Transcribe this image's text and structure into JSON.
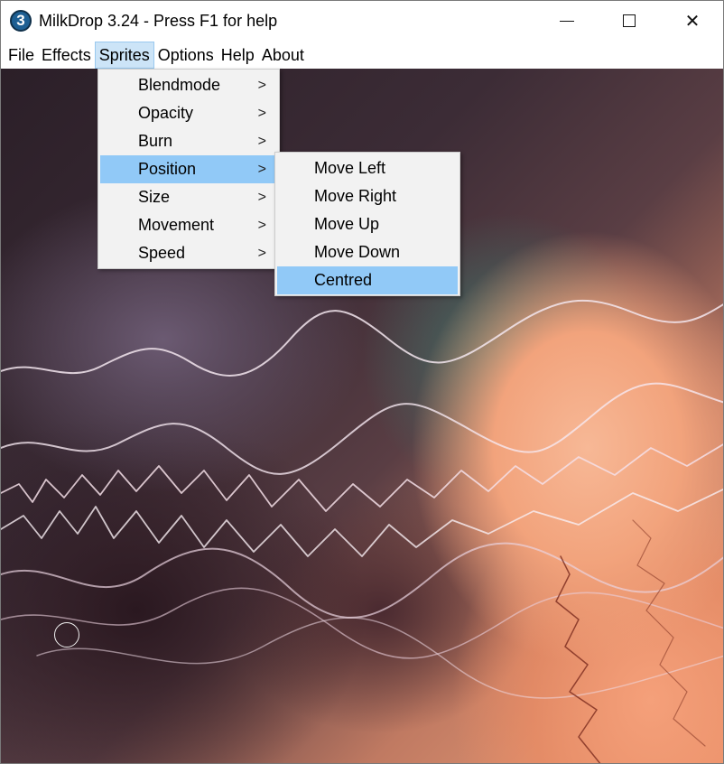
{
  "window": {
    "icon_text": "3",
    "title": "MilkDrop 3.24 - Press F1 for help",
    "controls": {
      "minimize": "minimize-icon",
      "maximize": "maximize-icon",
      "close": "close-icon"
    }
  },
  "menubar": {
    "items": [
      {
        "label": "File"
      },
      {
        "label": "Effects"
      },
      {
        "label": "Sprites"
      },
      {
        "label": "Options"
      },
      {
        "label": "Help"
      },
      {
        "label": "About"
      }
    ],
    "active": "Sprites"
  },
  "sprites_menu": {
    "items": [
      {
        "label": "Blendmode",
        "submenu": ">"
      },
      {
        "label": "Opacity",
        "submenu": ">"
      },
      {
        "label": "Burn",
        "submenu": ">"
      },
      {
        "label": "Position",
        "submenu": ">"
      },
      {
        "label": "Size",
        "submenu": ">"
      },
      {
        "label": "Movement",
        "submenu": ">"
      },
      {
        "label": "Speed",
        "submenu": ">"
      }
    ],
    "highlighted": "Position"
  },
  "position_menu": {
    "items": [
      {
        "label": "Move Left"
      },
      {
        "label": "Move Right"
      },
      {
        "label": "Move Up"
      },
      {
        "label": "Move Down"
      },
      {
        "label": "Centred"
      }
    ],
    "highlighted": "Centred"
  },
  "colors": {
    "menu_bg": "#f2f2f2",
    "menu_highlight": "#91c9f7",
    "menubar_active": "#cce4f7"
  }
}
